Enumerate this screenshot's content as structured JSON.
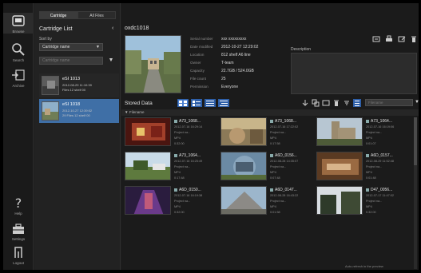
{
  "rail": {
    "browse": "Browse",
    "search": "Search",
    "archive": "Archive",
    "help": "Help",
    "settings": "Settings",
    "logout": "Logout"
  },
  "cartridge_panel": {
    "tabs": [
      "Cartridge",
      "All Files"
    ],
    "title": "Cartridge List",
    "sort_label": "Sort by",
    "sort_value": "Cartridge name",
    "filter_placeholder": "Cartridge name",
    "items": [
      {
        "id": "eSI 1013",
        "line1": "2012-08-29 11:10:39",
        "line2": "Files 12 shelf 00"
      },
      {
        "id": "eSI 1018",
        "line1": "2012-10-27 12:39:02",
        "line2": "29 Files 12 shelf 00"
      }
    ]
  },
  "main": {
    "title": "oxdc1018",
    "details": [
      {
        "k": "Serial number",
        "v": "xxx xxxxxxxxx"
      },
      {
        "k": "Date modified",
        "v": "2012-10-27 12:29:02"
      },
      {
        "k": "Location",
        "v": "812 shelf A6 line"
      },
      {
        "k": "Owner",
        "v": "T-team"
      },
      {
        "k": "Capacity",
        "v": "22.7GB / 524.0GB"
      },
      {
        "k": "File count",
        "v": "25"
      },
      {
        "k": "Permission",
        "v": "Everyone"
      }
    ],
    "description_label": "Description",
    "stored_title": "Stored Data",
    "search_placeholder": "Filename",
    "group_label": "Filename",
    "status": "Auto-refresh in the preview"
  },
  "tiles": [
    {
      "name": "A73_1068...",
      "l1": "2012-07-16 16:29:14",
      "l2": "Project na...",
      "l3": "MP4",
      "l4": "0:32:00"
    },
    {
      "name": "A73_1068...",
      "l1": "2012-07-16 17:22:02",
      "l2": "Project na...",
      "l3": "MP4",
      "l4": "0:17:58"
    },
    {
      "name": "A73_1064...",
      "l1": "2012-07-16 16:19:06",
      "l2": "Project na...",
      "l3": "MP4",
      "l4": "0:01:07"
    },
    {
      "name": "A73_1064...",
      "l1": "2012-07-16 16:25:49",
      "l2": "Project na...",
      "l3": "MP4",
      "l4": "0:17:48"
    },
    {
      "name": "A6D_0156...",
      "l1": "2012-08-28 14:35:07",
      "l2": "Project na...",
      "l3": "MP4",
      "l4": "0:07:48"
    },
    {
      "name": "A6D_0157...",
      "l1": "2012-08-29 11:52:48",
      "l2": "Project na...",
      "l3": "MP4",
      "l4": "0:01:48"
    },
    {
      "name": "A6D_0150...",
      "l1": "2012-07-16 16:19:38",
      "l2": "Project na...",
      "l3": "MP4",
      "l4": "0:32:00"
    },
    {
      "name": "A6D_0147...",
      "l1": "2012-08-28 16:43:22",
      "l2": "Project na...",
      "l3": "MP4",
      "l4": "0:01:58"
    },
    {
      "name": "D47_0056...",
      "l1": "2012-07-17 11:47:02",
      "l2": "Project na...",
      "l3": "MP4",
      "l4": "0:32:00"
    }
  ]
}
